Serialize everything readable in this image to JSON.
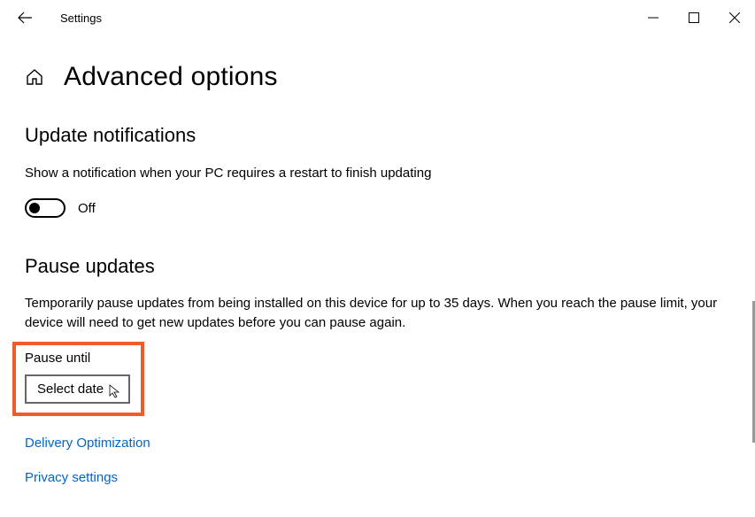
{
  "titlebar": {
    "app_title": "Settings"
  },
  "page": {
    "title": "Advanced options"
  },
  "update_notifications": {
    "heading": "Update notifications",
    "description": "Show a notification when your PC requires a restart to finish updating",
    "toggle_state": "Off"
  },
  "pause_updates": {
    "heading": "Pause updates",
    "description": "Temporarily pause updates from being installed on this device for up to 35 days. When you reach the pause limit, your device will need to get new updates before you can pause again.",
    "pause_until_label": "Pause until",
    "select_date_label": "Select date"
  },
  "links": {
    "delivery_optimization": "Delivery Optimization",
    "privacy_settings": "Privacy settings"
  }
}
